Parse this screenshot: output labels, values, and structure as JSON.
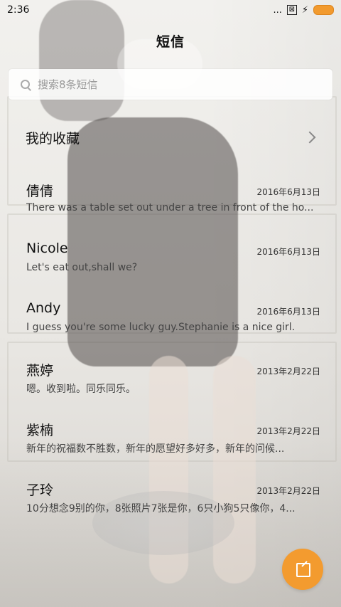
{
  "status": {
    "time": "2:36",
    "icons": {
      "dots": "...",
      "notification": "⊠",
      "bolt": "⚡"
    },
    "colors": {
      "battery": "#f39b2f"
    }
  },
  "header": {
    "title": "短信"
  },
  "search": {
    "placeholder": "搜索8条短信"
  },
  "favorites": {
    "label": "我的收藏"
  },
  "messages": [
    {
      "name": "倩倩",
      "date": "2016年6月13日",
      "preview": "There was a table set out under a tree in front of the ho..."
    },
    {
      "name": "Nicole",
      "date": "2016年6月13日",
      "preview": "Let's eat out,shall we?"
    },
    {
      "name": "Andy",
      "date": "2016年6月13日",
      "preview": "I guess you're some lucky guy.Stephanie is a nice girl."
    },
    {
      "name": "燕婷",
      "date": "2013年2月22日",
      "preview": "嗯。收到啦。同乐同乐。"
    },
    {
      "name": "紫楠",
      "date": "2013年2月22日",
      "preview": "新年的祝福数不胜数，新年的愿望好多好多，新年的问候..."
    },
    {
      "name": "子玲",
      "date": "2013年2月22日",
      "preview": "10分想念9别的你，8张照片7张是你，6只小狗5只像你，4..."
    }
  ],
  "fab": {
    "icon": "compose-icon",
    "color": "#f39b2f"
  }
}
